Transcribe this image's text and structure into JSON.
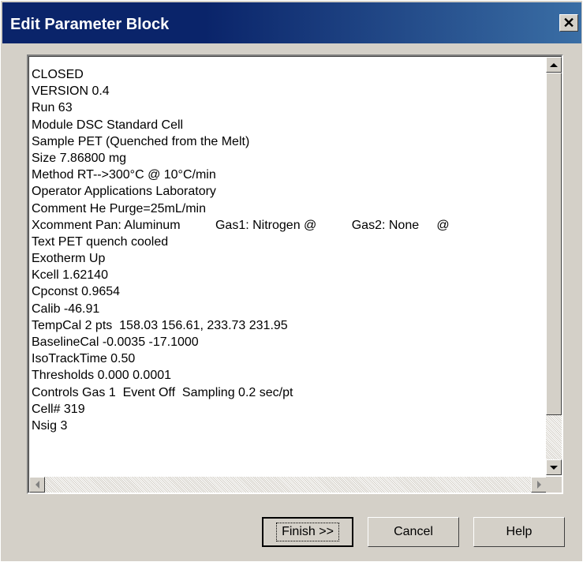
{
  "window": {
    "title": "Edit Parameter Block",
    "close_glyph": "✕"
  },
  "editor": {
    "lines": [
      "CLOSED",
      "VERSION 0.4",
      "Run 63",
      "Module DSC Standard Cell",
      "Sample PET (Quenched from the Melt)",
      "Size 7.86800 mg",
      "Method RT-->300°C @ 10°C/min",
      "Operator Applications Laboratory",
      "Comment He Purge=25mL/min",
      "Xcomment Pan: Aluminum          Gas1: Nitrogen @          Gas2: None     @",
      "Text PET quench cooled",
      "Exotherm Up",
      "Kcell 1.62140",
      "Cpconst 0.9654",
      "Calib -46.91",
      "TempCal 2 pts  158.03 156.61, 233.73 231.95",
      "BaselineCal -0.0035 -17.1000",
      "IsoTrackTime 0.50",
      "Thresholds 0.000 0.0001",
      "Controls Gas 1  Event Off  Sampling 0.2 sec/pt",
      "Cell# 319",
      "Nsig 3"
    ]
  },
  "buttons": {
    "finish": "Finish >>",
    "cancel": "Cancel",
    "help": "Help"
  },
  "icons": {
    "close": "close-icon",
    "scroll_up": "arrow-up-icon",
    "scroll_down": "arrow-down-icon",
    "scroll_left": "arrow-left-icon",
    "scroll_right": "arrow-right-icon"
  }
}
